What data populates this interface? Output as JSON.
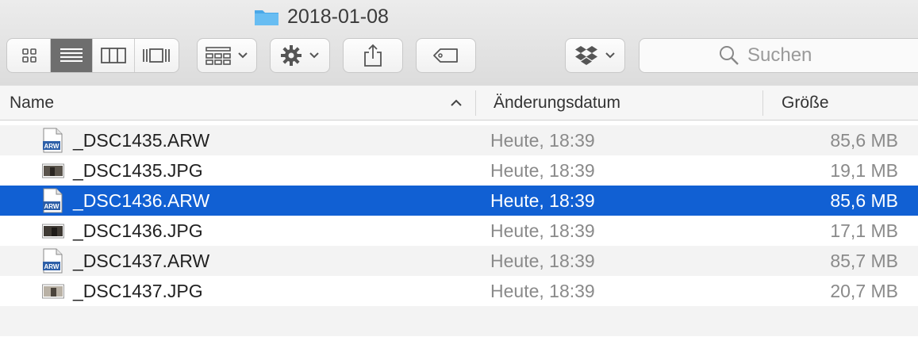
{
  "window": {
    "title": "2018-01-08"
  },
  "toolbar": {
    "view_buttons": [
      "icon-view",
      "list-view",
      "column-view",
      "gallery-view"
    ],
    "active_view": "list-view",
    "search_placeholder": "Suchen"
  },
  "columns": {
    "name": "Name",
    "date": "Änderungsdatum",
    "size": "Größe",
    "sort": "ascending"
  },
  "files": [
    {
      "name": "_DSC1435.ARW",
      "date": "Heute, 18:39",
      "size": "85,6 MB",
      "icon": "arw-file-icon",
      "selected": false
    },
    {
      "name": "_DSC1435.JPG",
      "date": "Heute, 18:39",
      "size": "19,1 MB",
      "icon": "jpg-thumbnail-icon",
      "selected": false
    },
    {
      "name": "_DSC1436.ARW",
      "date": "Heute, 18:39",
      "size": "85,6 MB",
      "icon": "arw-file-icon",
      "selected": true
    },
    {
      "name": "_DSC1436.JPG",
      "date": "Heute, 18:39",
      "size": "17,1 MB",
      "icon": "jpg-thumbnail-icon",
      "selected": false
    },
    {
      "name": "_DSC1437.ARW",
      "date": "Heute, 18:39",
      "size": "85,7 MB",
      "icon": "arw-file-icon",
      "selected": false
    },
    {
      "name": "_DSC1437.JPG",
      "date": "Heute, 18:39",
      "size": "20,7 MB",
      "icon": "jpg-thumbnail-icon",
      "selected": false
    }
  ],
  "colors": {
    "selection": "#1160d3",
    "folder": "#4aa8e8",
    "arw_badge": "#2d5fa8"
  }
}
